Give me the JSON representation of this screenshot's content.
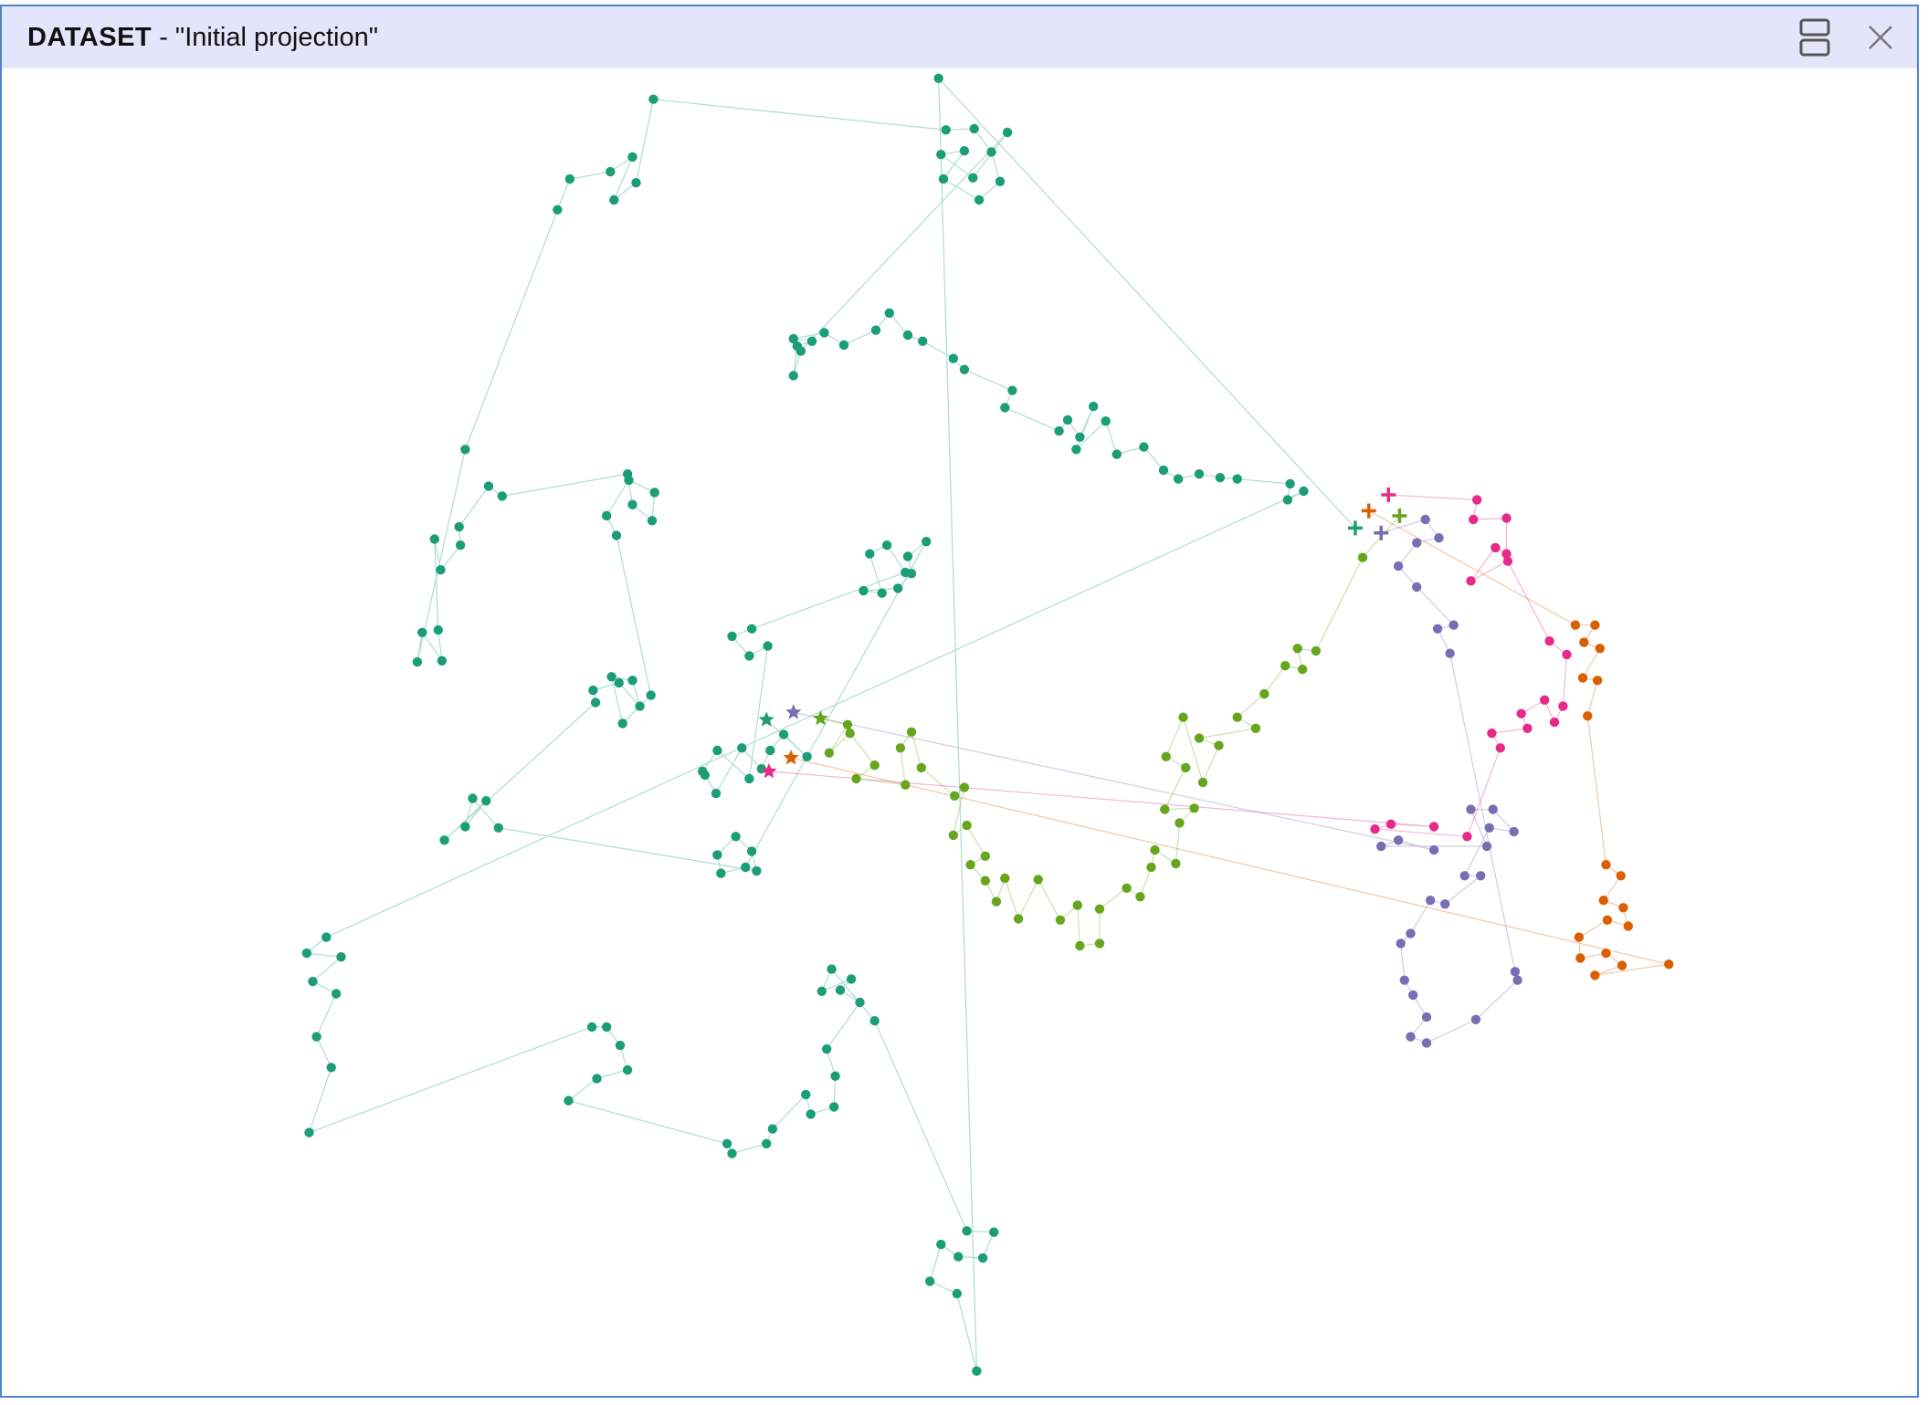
{
  "window": {
    "title_prefix": "DATASET",
    "title_separator": " - ",
    "title_name": "\"Initial projection\"",
    "icons": [
      "split-view-icon",
      "close-icon"
    ]
  },
  "colors": {
    "series1": "#1b9e77",
    "series2": "#d95f02",
    "series3": "#7570b3",
    "series4": "#e7298a",
    "series5": "#66a61e",
    "titlebar": "#e3e6fa",
    "border": "#4a86c8"
  },
  "chart_data": {
    "type": "scatter",
    "title": "",
    "xlabel": "",
    "ylabel": "",
    "axes_visible": false,
    "grid": false,
    "legend": "none",
    "xlim": [
      0,
      1400
    ],
    "ylim": [
      0,
      1110
    ],
    "marker_legend": {
      "star": "trajectory start",
      "plus": "trajectory end",
      "circle": "intermediate state"
    },
    "series": [
      {
        "color": "#1b9e77",
        "start": [
          622,
          530
        ],
        "points": [
          [
            655,
            560
          ],
          [
            636,
            542
          ],
          [
            625,
            555
          ],
          [
            618,
            570
          ],
          [
            602,
            553
          ],
          [
            581,
            590
          ],
          [
            572,
            575
          ],
          [
            570,
            572
          ],
          [
            582,
            555
          ],
          [
            608,
            578
          ],
          [
            623,
            470
          ],
          [
            608,
            478
          ],
          [
            594,
            462
          ],
          [
            610,
            456
          ],
          [
            735,
            410
          ],
          [
            720,
            388
          ],
          [
            706,
            395
          ],
          [
            716,
            427
          ],
          [
            701,
            425
          ],
          [
            729,
            423
          ],
          [
            740,
            411
          ],
          [
            737,
            397
          ],
          [
            752,
            385
          ],
          [
            605,
            650
          ],
          [
            585,
            655
          ],
          [
            582,
            640
          ],
          [
            597,
            625
          ],
          [
            610,
            637
          ],
          [
            614,
            653
          ],
          [
            404,
            618
          ],
          [
            383,
            594
          ],
          [
            377,
            617
          ],
          [
            394,
            596
          ],
          [
            360,
            628
          ],
          [
            483,
            516
          ],
          [
            481,
            506
          ],
          [
            502,
            500
          ],
          [
            519,
            519
          ],
          [
            513,
            498
          ],
          [
            496,
            495
          ],
          [
            505,
            533
          ],
          [
            528,
            510
          ],
          [
            500,
            380
          ],
          [
            492,
            364
          ],
          [
            510,
            335
          ],
          [
            531,
            345
          ],
          [
            529,
            368
          ],
          [
            513,
            355
          ],
          [
            509,
            330
          ],
          [
            407,
            348
          ],
          [
            396,
            340
          ],
          [
            372,
            373
          ],
          [
            373,
            388
          ],
          [
            357,
            408
          ],
          [
            352,
            383
          ],
          [
            355,
            457
          ],
          [
            358,
            482
          ],
          [
            342,
            459
          ],
          [
            338,
            483
          ],
          [
            377,
            310
          ],
          [
            452,
            115
          ],
          [
            462,
            90
          ],
          [
            495,
            84
          ],
          [
            513,
            72
          ],
          [
            498,
            107
          ],
          [
            516,
            93
          ],
          [
            530,
            25
          ],
          [
            768,
            50
          ],
          [
            791,
            49
          ],
          [
            805,
            68
          ],
          [
            812,
            92
          ],
          [
            795,
            107
          ],
          [
            766,
            90
          ],
          [
            783,
            67
          ],
          [
            764,
            70
          ],
          [
            790,
            89
          ],
          [
            818,
            52
          ],
          [
            650,
            230
          ],
          [
            644,
            250
          ],
          [
            647,
            226
          ],
          [
            659,
            222
          ],
          [
            644,
            220
          ],
          [
            669,
            215
          ],
          [
            685,
            225
          ],
          [
            711,
            213
          ],
          [
            722,
            199
          ],
          [
            737,
            217
          ],
          [
            749,
            222
          ],
          [
            774,
            236
          ],
          [
            783,
            245
          ],
          [
            822,
            262
          ],
          [
            816,
            276
          ],
          [
            860,
            295
          ],
          [
            867,
            286
          ],
          [
            877,
            300
          ],
          [
            888,
            275
          ],
          [
            874,
            310
          ],
          [
            898,
            287
          ],
          [
            907,
            314
          ],
          [
            929,
            308
          ],
          [
            945,
            327
          ],
          [
            957,
            334
          ],
          [
            974,
            330
          ],
          [
            991,
            333
          ],
          [
            1005,
            334
          ],
          [
            1048,
            338
          ],
          [
            1046,
            351
          ],
          [
            1059,
            344
          ],
          [
            264,
            707
          ],
          [
            248,
            720
          ],
          [
            276,
            723
          ],
          [
            253,
            743
          ],
          [
            272,
            753
          ],
          [
            256,
            788
          ],
          [
            268,
            813
          ],
          [
            250,
            866
          ],
          [
            480,
            780
          ],
          [
            492,
            780
          ],
          [
            503,
            795
          ],
          [
            509,
            815
          ],
          [
            484,
            822
          ],
          [
            461,
            840
          ],
          [
            590,
            875
          ],
          [
            594,
            883
          ],
          [
            622,
            875
          ],
          [
            627,
            863
          ],
          [
            654,
            835
          ],
          [
            658,
            851
          ],
          [
            677,
            845
          ],
          [
            678,
            820
          ],
          [
            671,
            798
          ],
          [
            698,
            760
          ],
          [
            682,
            750
          ],
          [
            691,
            741
          ],
          [
            667,
            751
          ],
          [
            675,
            733
          ],
          [
            710,
            775
          ],
          [
            785,
            946
          ],
          [
            807,
            947
          ],
          [
            798,
            968
          ],
          [
            778,
            967
          ],
          [
            764,
            957
          ],
          [
            755,
            987
          ],
          [
            777,
            997
          ],
          [
            793,
            1060
          ],
          [
            762,
            8
          ]
        ],
        "end": [
          1101,
          374
        ]
      },
      {
        "color": "#d95f02",
        "start": [
          642,
          561
        ],
        "points": [
          [
            1356,
            729
          ],
          [
            1296,
            738
          ],
          [
            1318,
            730
          ],
          [
            1305,
            720
          ],
          [
            1284,
            724
          ],
          [
            1283,
            707
          ],
          [
            1306,
            693
          ],
          [
            1323,
            698
          ],
          [
            1319,
            683
          ],
          [
            1303,
            677
          ],
          [
            1317,
            657
          ],
          [
            1305,
            648
          ],
          [
            1290,
            527
          ],
          [
            1298,
            498
          ],
          [
            1286,
            496
          ],
          [
            1300,
            472
          ],
          [
            1287,
            467
          ],
          [
            1296,
            453
          ],
          [
            1280,
            453
          ]
        ],
        "end": [
          1112,
          360
        ]
      },
      {
        "color": "#7570b3",
        "start": [
          644,
          524
        ],
        "points": [
          [
            1165,
            636
          ],
          [
            1136,
            628
          ],
          [
            1122,
            633
          ],
          [
            1208,
            633
          ],
          [
            1195,
            603
          ],
          [
            1213,
            603
          ],
          [
            1230,
            621
          ],
          [
            1210,
            618
          ],
          [
            1190,
            657
          ],
          [
            1203,
            657
          ],
          [
            1174,
            680
          ],
          [
            1162,
            677
          ],
          [
            1146,
            704
          ],
          [
            1138,
            712
          ],
          [
            1141,
            742
          ],
          [
            1148,
            754
          ],
          [
            1159,
            772
          ],
          [
            1146,
            788
          ],
          [
            1159,
            793
          ],
          [
            1199,
            774
          ],
          [
            1233,
            742
          ],
          [
            1231,
            735
          ],
          [
            1178,
            476
          ],
          [
            1168,
            456
          ],
          [
            1181,
            453
          ],
          [
            1151,
            422
          ],
          [
            1136,
            405
          ],
          [
            1151,
            386
          ],
          [
            1169,
            382
          ],
          [
            1158,
            367
          ]
        ],
        "end": [
          1122,
          378
        ]
      },
      {
        "color": "#e7298a",
        "start": [
          624,
          572
        ],
        "points": [
          [
            1165,
            617
          ],
          [
            1130,
            615
          ],
          [
            1117,
            619
          ],
          [
            1192,
            625
          ],
          [
            1219,
            553
          ],
          [
            1212,
            541
          ],
          [
            1241,
            537
          ],
          [
            1236,
            525
          ],
          [
            1255,
            514
          ],
          [
            1263,
            532
          ],
          [
            1270,
            519
          ],
          [
            1273,
            477
          ],
          [
            1259,
            466
          ],
          [
            1225,
            401
          ],
          [
            1195,
            417
          ],
          [
            1215,
            390
          ],
          [
            1224,
            395
          ],
          [
            1224,
            366
          ],
          [
            1197,
            367
          ],
          [
            1200,
            351
          ]
        ],
        "end": [
          1128,
          347
        ]
      },
      {
        "color": "#66a61e",
        "start": [
          666,
          529
        ],
        "points": [
          [
            688,
            534
          ],
          [
            673,
            557
          ],
          [
            690,
            541
          ],
          [
            710,
            567
          ],
          [
            695,
            578
          ],
          [
            735,
            583
          ],
          [
            731,
            553
          ],
          [
            740,
            540
          ],
          [
            748,
            569
          ],
          [
            775,
            592
          ],
          [
            783,
            585
          ],
          [
            774,
            624
          ],
          [
            785,
            616
          ],
          [
            800,
            641
          ],
          [
            788,
            648
          ],
          [
            800,
            661
          ],
          [
            809,
            678
          ],
          [
            816,
            659
          ],
          [
            827,
            692
          ],
          [
            843,
            660
          ],
          [
            861,
            693
          ],
          [
            875,
            681
          ],
          [
            877,
            714
          ],
          [
            893,
            712
          ],
          [
            893,
            684
          ],
          [
            915,
            667
          ],
          [
            926,
            674
          ],
          [
            935,
            650
          ],
          [
            938,
            636
          ],
          [
            955,
            647
          ],
          [
            958,
            614
          ],
          [
            970,
            602
          ],
          [
            946,
            603
          ],
          [
            963,
            569
          ],
          [
            947,
            560
          ],
          [
            961,
            528
          ],
          [
            977,
            581
          ],
          [
            990,
            551
          ],
          [
            974,
            545
          ],
          [
            1020,
            537
          ],
          [
            1005,
            528
          ],
          [
            1027,
            509
          ],
          [
            1044,
            486
          ],
          [
            1058,
            489
          ],
          [
            1054,
            472
          ],
          [
            1069,
            474
          ],
          [
            1107,
            398
          ]
        ],
        "end": [
          1137,
          364
        ]
      }
    ]
  }
}
